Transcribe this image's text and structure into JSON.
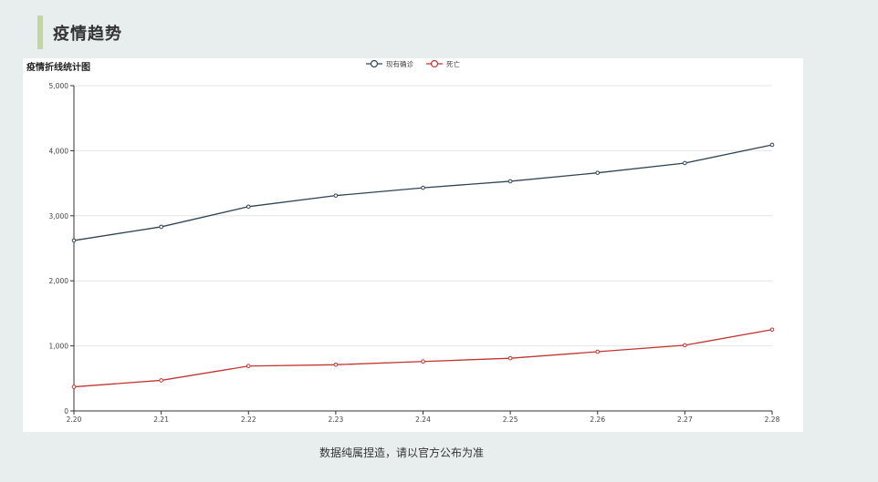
{
  "section": {
    "title": "疫情趋势"
  },
  "footnote": "数据纯属捏造，请以官方公布为准",
  "colors": {
    "accent": "#c3d5a4",
    "series_existing": "#2f4554",
    "series_death": "#c23531"
  },
  "chart_data": {
    "type": "line",
    "title": "疫情折线统计图",
    "xlabel": "",
    "ylabel": "",
    "categories": [
      "2.20",
      "2.21",
      "2.22",
      "2.23",
      "2.24",
      "2.25",
      "2.26",
      "2.27",
      "2.28"
    ],
    "y_ticks": [
      "0",
      "1,000",
      "2,000",
      "3,000",
      "4,000",
      "5,000"
    ],
    "ylim": [
      0,
      5000
    ],
    "grid": true,
    "legend_position": "top-center",
    "series": [
      {
        "name": "现有确诊",
        "color": "#2f4554",
        "values": [
          2620,
          2830,
          3140,
          3310,
          3430,
          3530,
          3660,
          3810,
          4090
        ]
      },
      {
        "name": "死亡",
        "color": "#c23531",
        "values": [
          370,
          470,
          690,
          710,
          760,
          810,
          910,
          1010,
          1250
        ]
      }
    ]
  }
}
